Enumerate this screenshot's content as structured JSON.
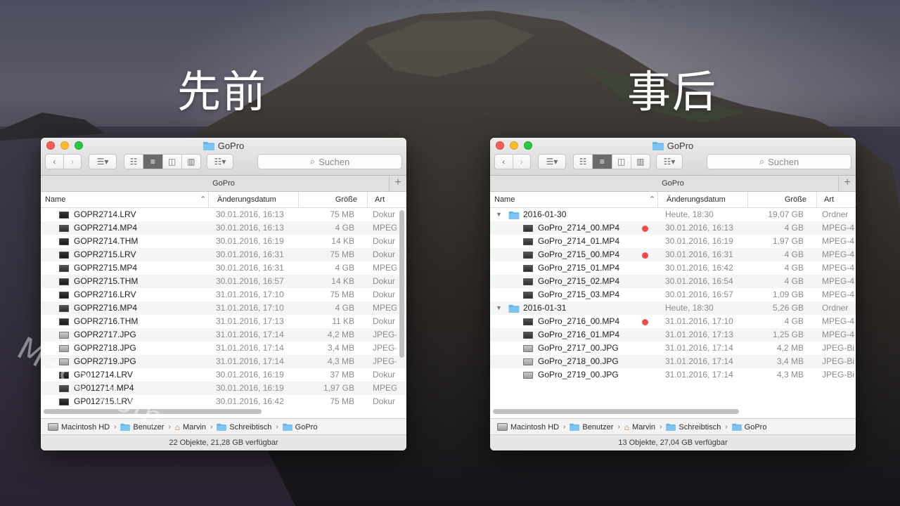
{
  "captions": {
    "before": "先前",
    "after": "事后"
  },
  "watermark": "Macz.com",
  "left_window": {
    "title": "GoPro",
    "search_placeholder": "Suchen",
    "tab_label": "GoPro",
    "columns": {
      "name": "Name",
      "date": "Änderungsdatum",
      "size": "Größe",
      "kind": "Art"
    },
    "rows": [
      {
        "name": "GOPR2714.LRV",
        "date": "30.01.2016, 16:13",
        "size": "75 MB",
        "kind": "Dokur"
      },
      {
        "name": "GOPR2714.MP4",
        "date": "30.01.2016, 16:13",
        "size": "4 GB",
        "kind": "MPEG"
      },
      {
        "name": "GOPR2714.THM",
        "date": "30.01.2016, 16:19",
        "size": "14 KB",
        "kind": "Dokur"
      },
      {
        "name": "GOPR2715.LRV",
        "date": "30.01.2016, 16:31",
        "size": "75 MB",
        "kind": "Dokur"
      },
      {
        "name": "GOPR2715.MP4",
        "date": "30.01.2016, 16:31",
        "size": "4 GB",
        "kind": "MPEG"
      },
      {
        "name": "GOPR2715.THM",
        "date": "30.01.2016, 16:57",
        "size": "14 KB",
        "kind": "Dokur"
      },
      {
        "name": "GOPR2716.LRV",
        "date": "31.01.2016, 17:10",
        "size": "75 MB",
        "kind": "Dokur"
      },
      {
        "name": "GOPR2716.MP4",
        "date": "31.01.2016, 17:10",
        "size": "4 GB",
        "kind": "MPEG"
      },
      {
        "name": "GOPR2716.THM",
        "date": "31.01.2016, 17:13",
        "size": "11 KB",
        "kind": "Dokur"
      },
      {
        "name": "GOPR2717.JPG",
        "date": "31.01.2016, 17:14",
        "size": "4,2 MB",
        "kind": "JPEG-"
      },
      {
        "name": "GOPR2718.JPG",
        "date": "31.01.2016, 17:14",
        "size": "3,4 MB",
        "kind": "JPEG-"
      },
      {
        "name": "GOPR2719.JPG",
        "date": "31.01.2016, 17:14",
        "size": "4,3 MB",
        "kind": "JPEG-"
      },
      {
        "name": "GP012714.LRV",
        "date": "30.01.2016, 16:19",
        "size": "37 MB",
        "kind": "Dokur"
      },
      {
        "name": "GP012714.MP4",
        "date": "30.01.2016, 16:19",
        "size": "1,97 GB",
        "kind": "MPEG"
      },
      {
        "name": "GP012715.LRV",
        "date": "30.01.2016, 16:42",
        "size": "75 MB",
        "kind": "Dokur"
      }
    ],
    "path": [
      "Macintosh HD",
      "Benutzer",
      "Marvin",
      "Schreibtisch",
      "GoPro"
    ],
    "status": "22 Objekte, 21,28 GB verfügbar"
  },
  "right_window": {
    "title": "GoPro",
    "search_placeholder": "Suchen",
    "tab_label": "GoPro",
    "columns": {
      "name": "Name",
      "date": "Änderungsdatum",
      "size": "Größe",
      "kind": "Art"
    },
    "rows": [
      {
        "type": "folder",
        "name": "2016-01-30",
        "date": "Heute, 18:30",
        "size": "19,07 GB",
        "kind": "Ordner"
      },
      {
        "type": "file",
        "name": "GoPro_2714_00.MP4",
        "date": "30.01.2016, 16:13",
        "size": "4 GB",
        "kind": "MPEG-4",
        "tag": "red"
      },
      {
        "type": "file",
        "name": "GoPro_2714_01.MP4",
        "date": "30.01.2016, 16:19",
        "size": "1,97 GB",
        "kind": "MPEG-4"
      },
      {
        "type": "file",
        "name": "GoPro_2715_00.MP4",
        "date": "30.01.2016, 16:31",
        "size": "4 GB",
        "kind": "MPEG-4",
        "tag": "red"
      },
      {
        "type": "file",
        "name": "GoPro_2715_01.MP4",
        "date": "30.01.2016, 16:42",
        "size": "4 GB",
        "kind": "MPEG-4"
      },
      {
        "type": "file",
        "name": "GoPro_2715_02.MP4",
        "date": "30.01.2016, 16:54",
        "size": "4 GB",
        "kind": "MPEG-4"
      },
      {
        "type": "file",
        "name": "GoPro_2715_03.MP4",
        "date": "30.01.2016, 16:57",
        "size": "1,09 GB",
        "kind": "MPEG-4"
      },
      {
        "type": "folder",
        "name": "2016-01-31",
        "date": "Heute, 18:30",
        "size": "5,26 GB",
        "kind": "Ordner"
      },
      {
        "type": "file",
        "name": "GoPro_2716_00.MP4",
        "date": "31.01.2016, 17:10",
        "size": "4 GB",
        "kind": "MPEG-4",
        "tag": "red"
      },
      {
        "type": "file",
        "name": "GoPro_2716_01.MP4",
        "date": "31.01.2016, 17:13",
        "size": "1,25 GB",
        "kind": "MPEG-4"
      },
      {
        "type": "file",
        "name": "GoPro_2717_00.JPG",
        "date": "31.01.2016, 17:14",
        "size": "4,2 MB",
        "kind": "JPEG-Bi"
      },
      {
        "type": "file",
        "name": "GoPro_2718_00.JPG",
        "date": "31.01.2016, 17:14",
        "size": "3,4 MB",
        "kind": "JPEG-Bi"
      },
      {
        "type": "file",
        "name": "GoPro_2719_00.JPG",
        "date": "31.01.2016, 17:14",
        "size": "4,3 MB",
        "kind": "JPEG-Bi"
      }
    ],
    "path": [
      "Macintosh HD",
      "Benutzer",
      "Marvin",
      "Schreibtisch",
      "GoPro"
    ],
    "status": "13 Objekte, 27,04 GB verfügbar"
  },
  "colors": {
    "tag_red": "#f04b4b",
    "folder_blue": "#5fb3ee"
  }
}
